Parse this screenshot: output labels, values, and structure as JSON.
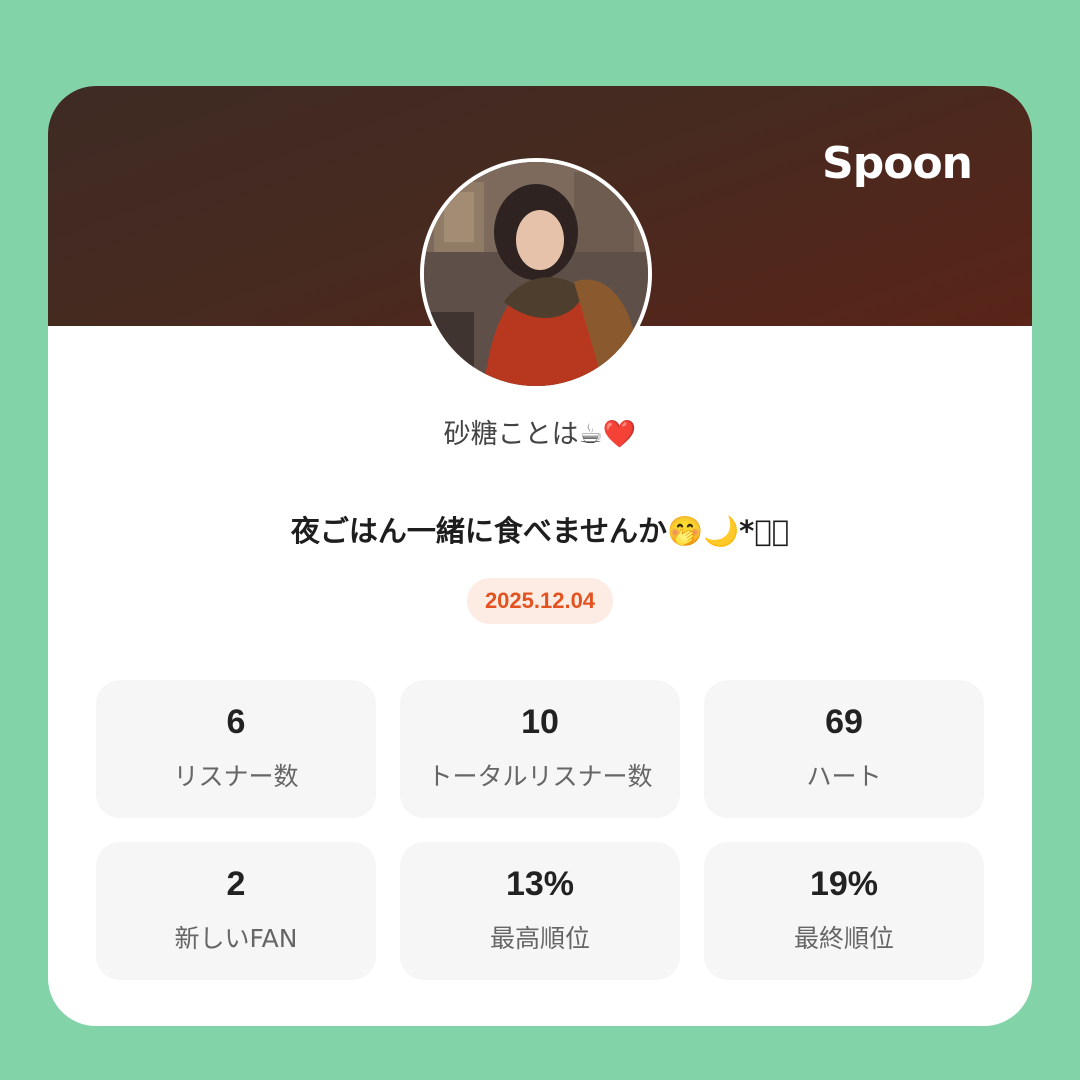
{
  "header": {
    "brand": "Spoon"
  },
  "profile": {
    "username": "砂糖ことは☕❤️",
    "avatar_icon": "avatar-illustration"
  },
  "broadcast": {
    "title": "夜ごはん一緒に食べませんか🤭🌙*ﾟ？",
    "date": "2025.12.04"
  },
  "stats": [
    {
      "value": "6",
      "label": "リスナー数"
    },
    {
      "value": "10",
      "label": "トータルリスナー数"
    },
    {
      "value": "69",
      "label": "ハート"
    },
    {
      "value": "2",
      "label": "新しいFAN"
    },
    {
      "value": "13%",
      "label": "最高順位"
    },
    {
      "value": "19%",
      "label": "最終順位"
    }
  ],
  "colors": {
    "background": "#82d4a8",
    "banner": "#462a20",
    "date_text": "#e4531f",
    "date_bg": "#fdece4"
  }
}
